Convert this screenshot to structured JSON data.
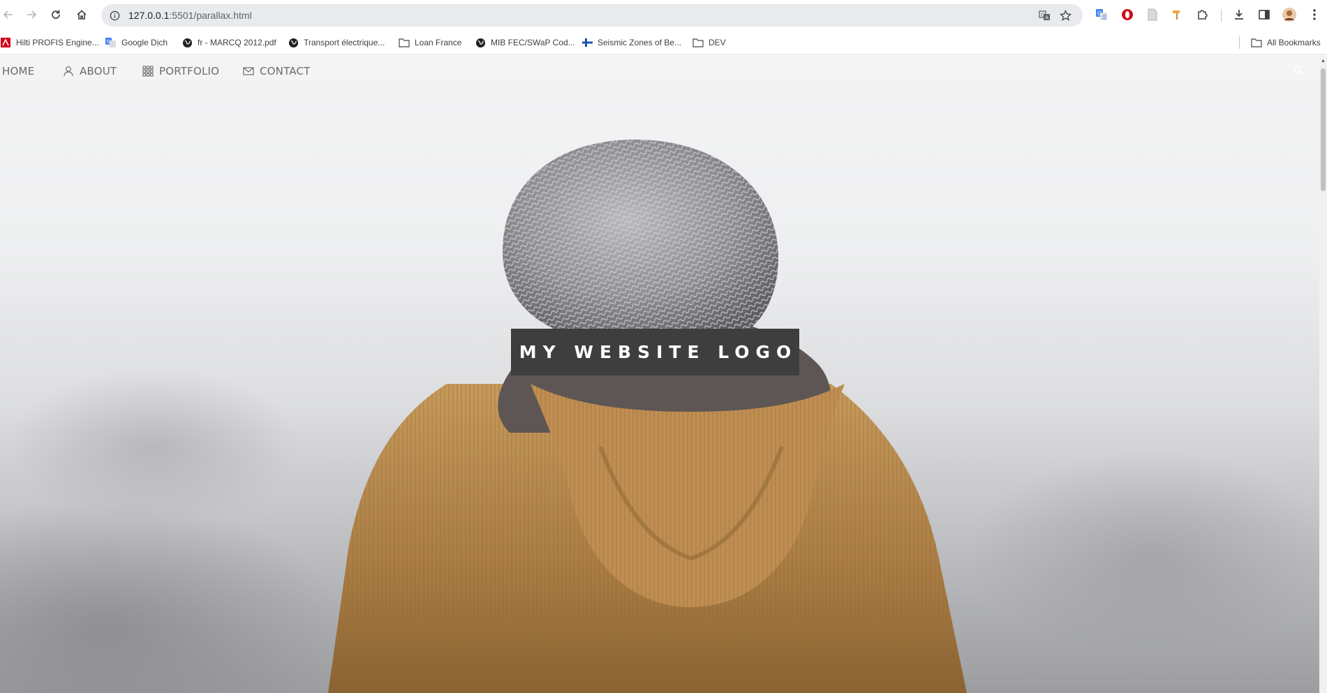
{
  "browser": {
    "url_host": "127.0.0.1",
    "url_path": ":5501/parallax.html",
    "bookmarks": [
      {
        "label": "Hilti PROFIS Engine...",
        "icon": "hilti-icon",
        "color": "#d2051e"
      },
      {
        "label": "Google Dịch",
        "icon": "google-translate-icon",
        "color": "#4285f4"
      },
      {
        "label": "fr - MARCQ 2012.pdf",
        "icon": "globe-icon",
        "color": "#202124"
      },
      {
        "label": "Transport électrique...",
        "icon": "globe-icon",
        "color": "#202124"
      },
      {
        "label": "Loan France",
        "icon": "folder-icon",
        "color": "#5f6368"
      },
      {
        "label": "MIB FEC/SWaP Cod...",
        "icon": "globe-icon",
        "color": "#202124"
      },
      {
        "label": "Seismic Zones of Be...",
        "icon": "flag-icon",
        "color": "#1a56a8"
      },
      {
        "label": "DEV",
        "icon": "folder-icon",
        "color": "#5f6368"
      }
    ],
    "all_bookmarks": "All Bookmarks"
  },
  "site": {
    "nav": [
      {
        "label": "HOME",
        "icon": ""
      },
      {
        "label": "ABOUT",
        "icon": "user-icon"
      },
      {
        "label": "PORTFOLIO",
        "icon": "grid-icon"
      },
      {
        "label": "CONTACT",
        "icon": "envelope-icon"
      }
    ],
    "logo": "MY WEBSITE LOGO"
  },
  "colors": {
    "logo_bg": "#3e3e3e",
    "nav_text": "#6b6b6b",
    "coat": "#b78a4e",
    "beanie": "#8d8d92"
  }
}
